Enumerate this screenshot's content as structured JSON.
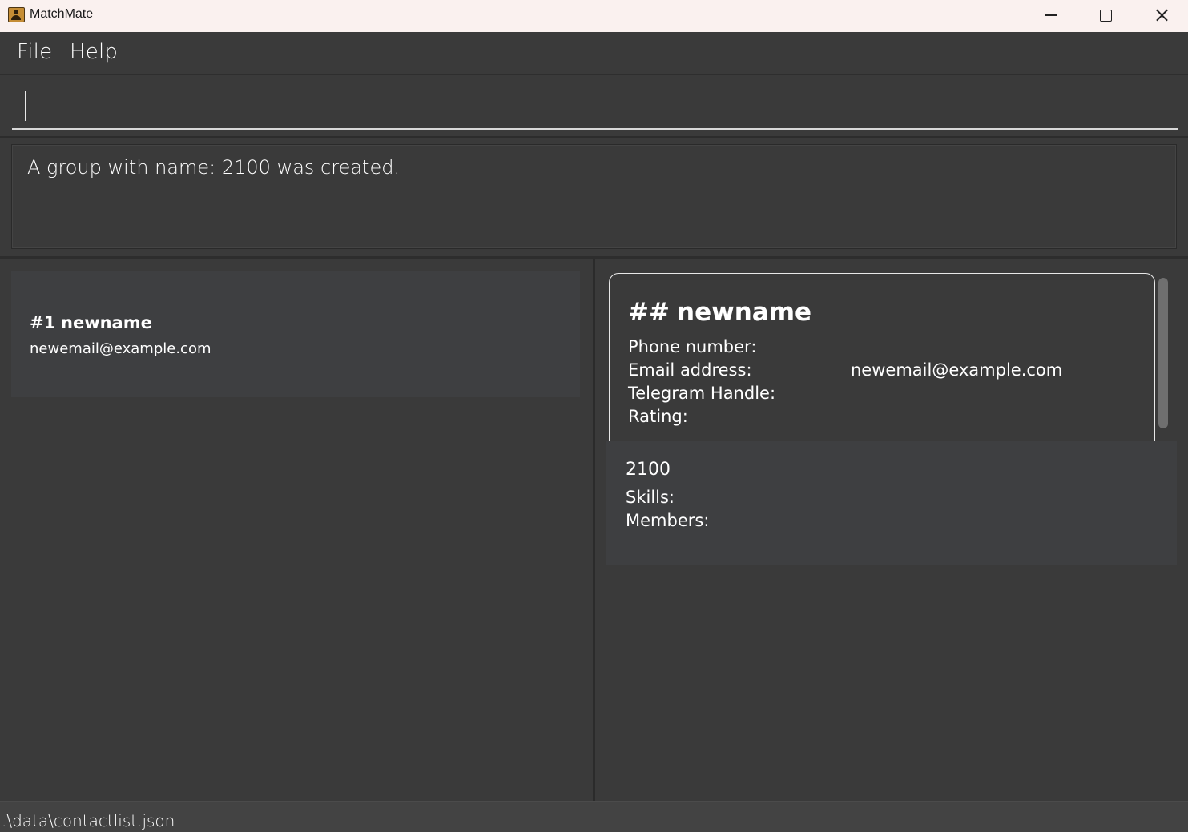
{
  "window": {
    "title": "MatchMate"
  },
  "menu": {
    "file": "File",
    "help": "Help"
  },
  "command": {
    "value": "",
    "placeholder": ""
  },
  "result": {
    "message": "A group with name: 2100 was created."
  },
  "person_list": [
    {
      "index": "#1",
      "name": "newname",
      "email": "newemail@example.com"
    }
  ],
  "detail": {
    "hash": "##",
    "name": "newname",
    "phone_label": "Phone number:",
    "phone_value": "",
    "email_label": "Email address:",
    "email_value": "newemail@example.com",
    "telegram_label": "Telegram Handle:",
    "telegram_value": "",
    "rating_label": "Rating:",
    "rating_value": ""
  },
  "group": {
    "name": "2100",
    "skills_label": "Skills:",
    "members_label": "Members:"
  },
  "status": {
    "path": ".\\data\\contactlist.json"
  },
  "icons": {
    "app": "contact-book-icon",
    "minimize": "minimize-icon",
    "maximize": "maximize-icon",
    "close": "close-icon"
  }
}
